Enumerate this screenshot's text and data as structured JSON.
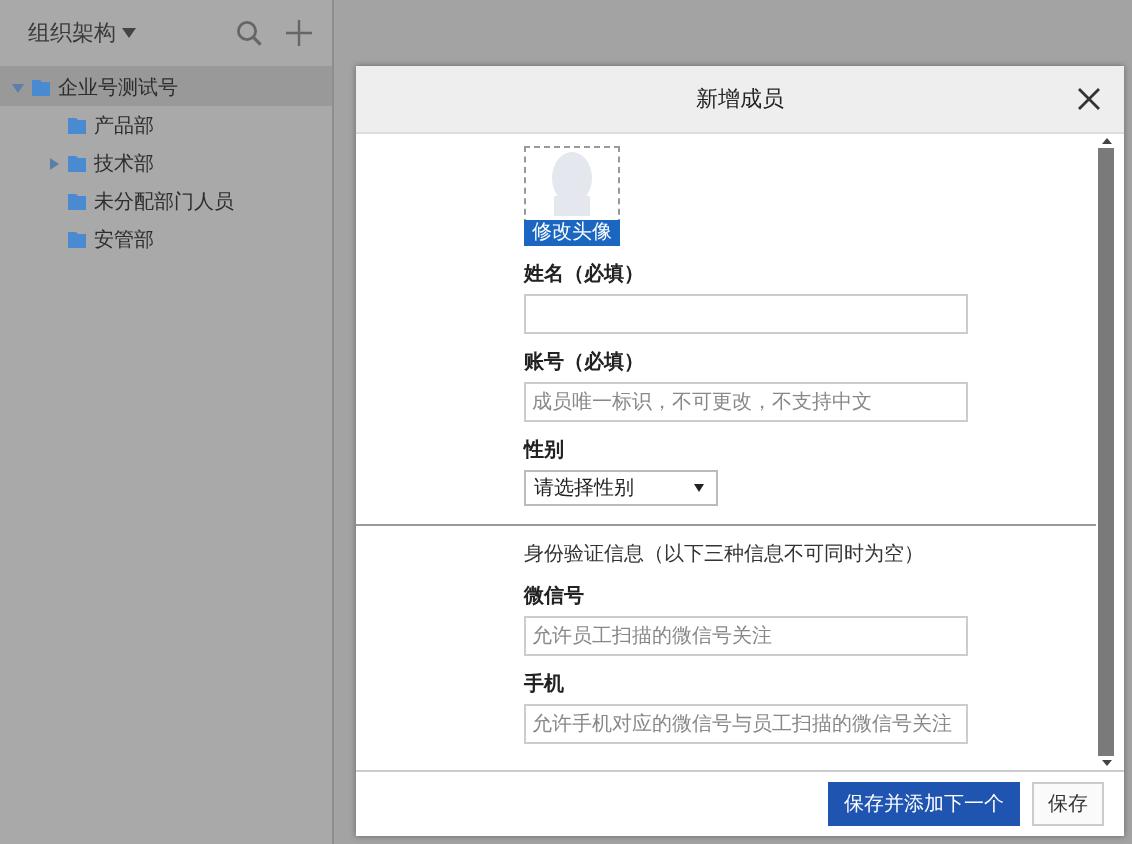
{
  "sidebar": {
    "title": "组织架构",
    "tree": [
      {
        "label": "企业号测试号",
        "selected": true,
        "expanded": true,
        "children": [
          {
            "label": "产品部",
            "selected": false
          },
          {
            "label": "技术部",
            "selected": false,
            "expanded": false
          },
          {
            "label": "未分配部门人员",
            "selected": false
          },
          {
            "label": "安管部",
            "selected": false
          }
        ]
      }
    ]
  },
  "dialog": {
    "title": "新增成员",
    "avatar_button": "修改头像",
    "fields": [
      {
        "kind": "input",
        "label": "姓名（必填）"
      },
      {
        "kind": "input",
        "label": "账号（必填）",
        "placeholder": "成员唯一标识，不可更改，不支持中文"
      },
      {
        "kind": "select",
        "label": "性别",
        "value": "请选择性别"
      },
      {
        "kind": "section",
        "label": "身份验证信息（以下三种信息不可同时为空）"
      },
      {
        "kind": "input",
        "label": "微信号",
        "placeholder": "允许员工扫描的微信号关注"
      },
      {
        "kind": "input",
        "label": "手机",
        "placeholder": "允许手机对应的微信号与员工扫描的微信号关注"
      }
    ],
    "buttons": [
      {
        "label": "保存并添加下一个",
        "primary": true
      },
      {
        "label": "保存",
        "primary": false
      }
    ]
  }
}
